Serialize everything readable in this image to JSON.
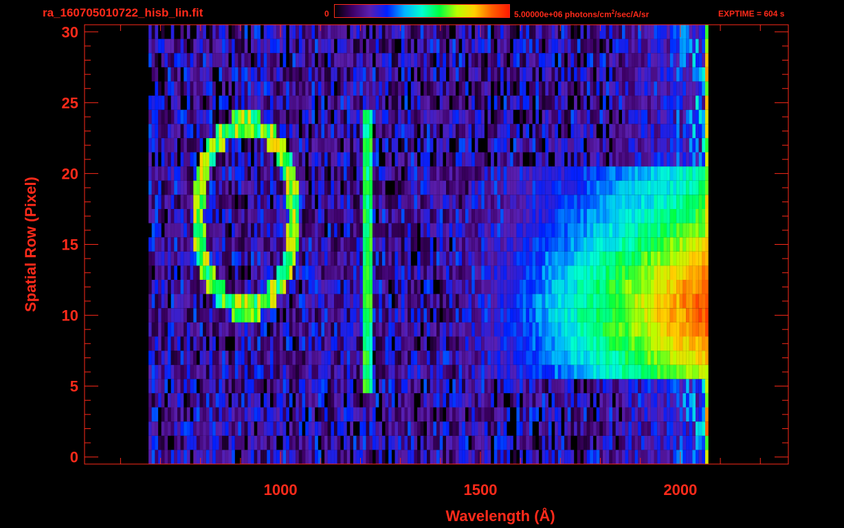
{
  "header": {
    "file_title": "ra_160705010722_hisb_lin.fit",
    "colorbar_min": "0",
    "colorbar_max_value": "5.00000e+06 photons/cm",
    "colorbar_max_sup": "2",
    "colorbar_max_units": "/sec/A/sr",
    "exptime_label": "EXPTIME = 604 s"
  },
  "colors": {
    "accent": "#ff2a1a",
    "background": "#000000",
    "colormap": [
      "#000000",
      "#3d0066",
      "#5a1fb0",
      "#0020ff",
      "#00b4ff",
      "#00ffd0",
      "#00ff40",
      "#b8ff00",
      "#ffd000",
      "#ff6000",
      "#ff1a00"
    ]
  },
  "chart_data": {
    "type": "heatmap",
    "title": "ra_160705010722_hisb_lin.fit",
    "xlabel": "Wavelength (Å)",
    "ylabel": "Spatial Row (Pixel)",
    "xlim": [
      510,
      2270
    ],
    "ylim": [
      -0.5,
      30.5
    ],
    "xticks": [
      1000,
      1500,
      2000
    ],
    "yticks": [
      0,
      5,
      10,
      15,
      20,
      25,
      30
    ],
    "colorbar": {
      "min": 0,
      "max": 5000000,
      "units": "photons/cm^2/sec/A/sr"
    },
    "data_extent": {
      "x": [
        670,
        2070
      ],
      "rows": [
        0,
        30
      ]
    },
    "features": [
      {
        "name": "continuum",
        "x": [
          1550,
          2070
        ],
        "rows": [
          6,
          20
        ],
        "peak_row": 10.5
      },
      {
        "name": "line-1216",
        "x": 1216,
        "rows": [
          5,
          24
        ]
      },
      {
        "name": "ring-loop",
        "center": [
          910,
          17
        ],
        "rows": [
          10,
          24
        ]
      }
    ]
  }
}
